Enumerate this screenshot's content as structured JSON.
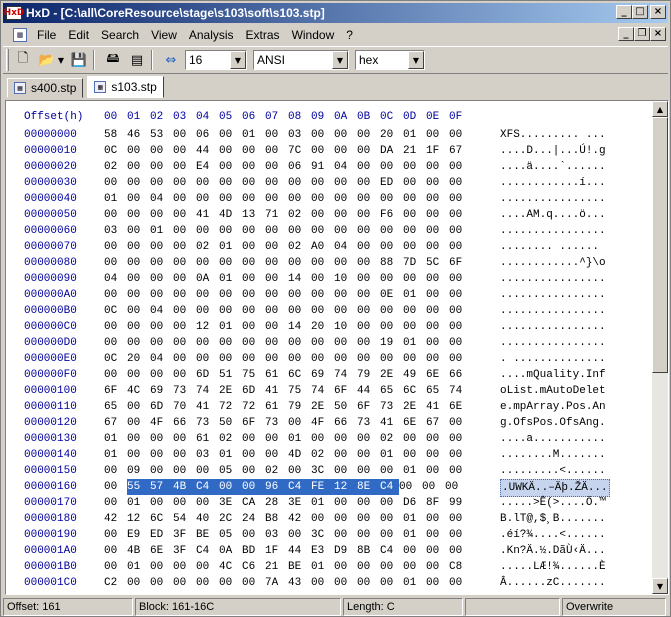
{
  "window": {
    "app_icon_text": "HxD",
    "title": "HxD - [C:\\all\\CoreResource\\stage\\s103\\soft\\s103.stp]"
  },
  "menu": {
    "items": [
      "File",
      "Edit",
      "Search",
      "View",
      "Analysis",
      "Extras",
      "Window",
      "?"
    ]
  },
  "toolbar": {
    "bytes_per_row": "16",
    "charset": "ANSI",
    "offset_base": "hex"
  },
  "tabs": [
    {
      "label": "s400.stp",
      "active": false
    },
    {
      "label": "s103.stp",
      "active": true
    }
  ],
  "hex": {
    "header_offset": "Offset(h)",
    "header_columns": [
      "00",
      "01",
      "02",
      "03",
      "04",
      "05",
      "06",
      "07",
      "08",
      "09",
      "0A",
      "0B",
      "0C",
      "0D",
      "0E",
      "0F"
    ],
    "rows": [
      {
        "offset": "00000000",
        "bytes": [
          "58",
          "46",
          "53",
          "00",
          "06",
          "00",
          "01",
          "00",
          "03",
          "00",
          "00",
          "00",
          "20",
          "01",
          "00",
          "00"
        ],
        "ascii": "XFS......... ..."
      },
      {
        "offset": "00000010",
        "bytes": [
          "0C",
          "00",
          "00",
          "00",
          "44",
          "00",
          "00",
          "00",
          "7C",
          "00",
          "00",
          "00",
          "DA",
          "21",
          "1F",
          "67"
        ],
        "ascii": "....D...|...Ú!.g"
      },
      {
        "offset": "00000020",
        "bytes": [
          "02",
          "00",
          "00",
          "00",
          "E4",
          "00",
          "00",
          "00",
          "06",
          "91",
          "04",
          "00",
          "00",
          "00",
          "00",
          "00"
        ],
        "ascii": "....ä....`......"
      },
      {
        "offset": "00000030",
        "bytes": [
          "00",
          "00",
          "00",
          "00",
          "00",
          "00",
          "00",
          "00",
          "00",
          "00",
          "00",
          "00",
          "ED",
          "00",
          "00",
          "00"
        ],
        "ascii": "............í..."
      },
      {
        "offset": "00000040",
        "bytes": [
          "01",
          "00",
          "04",
          "00",
          "00",
          "00",
          "00",
          "00",
          "00",
          "00",
          "00",
          "00",
          "00",
          "00",
          "00",
          "00"
        ],
        "ascii": "................"
      },
      {
        "offset": "00000050",
        "bytes": [
          "00",
          "00",
          "00",
          "00",
          "41",
          "4D",
          "13",
          "71",
          "02",
          "00",
          "00",
          "00",
          "F6",
          "00",
          "00",
          "00"
        ],
        "ascii": "....AM.q....ö..."
      },
      {
        "offset": "00000060",
        "bytes": [
          "03",
          "00",
          "01",
          "00",
          "00",
          "00",
          "00",
          "00",
          "00",
          "00",
          "00",
          "00",
          "00",
          "00",
          "00",
          "00"
        ],
        "ascii": "................"
      },
      {
        "offset": "00000070",
        "bytes": [
          "00",
          "00",
          "00",
          "00",
          "02",
          "01",
          "00",
          "00",
          "02",
          "A0",
          "04",
          "00",
          "00",
          "00",
          "00",
          "00"
        ],
        "ascii": "........ ......"
      },
      {
        "offset": "00000080",
        "bytes": [
          "00",
          "00",
          "00",
          "00",
          "00",
          "00",
          "00",
          "00",
          "00",
          "00",
          "00",
          "00",
          "88",
          "7D",
          "5C",
          "6F"
        ],
        "ascii": "............^}\\o"
      },
      {
        "offset": "00000090",
        "bytes": [
          "04",
          "00",
          "00",
          "00",
          "0A",
          "01",
          "00",
          "00",
          "14",
          "00",
          "10",
          "00",
          "00",
          "00",
          "00",
          "00"
        ],
        "ascii": "................"
      },
      {
        "offset": "000000A0",
        "bytes": [
          "00",
          "00",
          "00",
          "00",
          "00",
          "00",
          "00",
          "00",
          "00",
          "00",
          "00",
          "00",
          "0E",
          "01",
          "00",
          "00"
        ],
        "ascii": "................"
      },
      {
        "offset": "000000B0",
        "bytes": [
          "0C",
          "00",
          "04",
          "00",
          "00",
          "00",
          "00",
          "00",
          "00",
          "00",
          "00",
          "00",
          "00",
          "00",
          "00",
          "00"
        ],
        "ascii": "................"
      },
      {
        "offset": "000000C0",
        "bytes": [
          "00",
          "00",
          "00",
          "00",
          "12",
          "01",
          "00",
          "00",
          "14",
          "20",
          "10",
          "00",
          "00",
          "00",
          "00",
          "00"
        ],
        "ascii": "................"
      },
      {
        "offset": "000000D0",
        "bytes": [
          "00",
          "00",
          "00",
          "00",
          "00",
          "00",
          "00",
          "00",
          "00",
          "00",
          "00",
          "00",
          "19",
          "01",
          "00",
          "00"
        ],
        "ascii": "................"
      },
      {
        "offset": "000000E0",
        "bytes": [
          "0C",
          "20",
          "04",
          "00",
          "00",
          "00",
          "00",
          "00",
          "00",
          "00",
          "00",
          "00",
          "00",
          "00",
          "00",
          "00"
        ],
        "ascii": ". .............."
      },
      {
        "offset": "000000F0",
        "bytes": [
          "00",
          "00",
          "00",
          "00",
          "6D",
          "51",
          "75",
          "61",
          "6C",
          "69",
          "74",
          "79",
          "2E",
          "49",
          "6E",
          "66"
        ],
        "ascii": "....mQuality.Inf"
      },
      {
        "offset": "00000100",
        "bytes": [
          "6F",
          "4C",
          "69",
          "73",
          "74",
          "2E",
          "6D",
          "41",
          "75",
          "74",
          "6F",
          "44",
          "65",
          "6C",
          "65",
          "74"
        ],
        "ascii": "oList.mAutoDelet"
      },
      {
        "offset": "00000110",
        "bytes": [
          "65",
          "00",
          "6D",
          "70",
          "41",
          "72",
          "72",
          "61",
          "79",
          "2E",
          "50",
          "6F",
          "73",
          "2E",
          "41",
          "6E"
        ],
        "ascii": "e.mpArray.Pos.An"
      },
      {
        "offset": "00000120",
        "bytes": [
          "67",
          "00",
          "4F",
          "66",
          "73",
          "50",
          "6F",
          "73",
          "00",
          "4F",
          "66",
          "73",
          "41",
          "6E",
          "67",
          "00"
        ],
        "ascii": "g.OfsPos.OfsAng."
      },
      {
        "offset": "00000130",
        "bytes": [
          "01",
          "00",
          "00",
          "00",
          "61",
          "02",
          "00",
          "00",
          "01",
          "00",
          "00",
          "00",
          "02",
          "00",
          "00",
          "00"
        ],
        "ascii": "....a..........."
      },
      {
        "offset": "00000140",
        "bytes": [
          "01",
          "00",
          "00",
          "00",
          "03",
          "01",
          "00",
          "00",
          "4D",
          "02",
          "00",
          "00",
          "01",
          "00",
          "00",
          "00"
        ],
        "ascii": "........M......."
      },
      {
        "offset": "00000150",
        "bytes": [
          "00",
          "09",
          "00",
          "00",
          "00",
          "05",
          "00",
          "02",
          "00",
          "3C",
          "00",
          "00",
          "00",
          "01",
          "00",
          "00"
        ],
        "ascii": ".........<......"
      },
      {
        "offset": "00000160",
        "bytes": [
          "00",
          "55",
          "57",
          "4B",
          "C4",
          "00",
          "00",
          "96",
          "C4",
          "FE",
          "12",
          "8E",
          "C4",
          "00",
          "00",
          "00"
        ],
        "ascii": ".UWKÄ..–Äþ.ŽÄ...",
        "selected": true
      },
      {
        "offset": "00000170",
        "bytes": [
          "00",
          "01",
          "00",
          "00",
          "00",
          "3E",
          "CA",
          "28",
          "3E",
          "01",
          "00",
          "00",
          "00",
          "D6",
          "8F",
          "99"
        ],
        "ascii": ".....>Ê(>....Ö.™"
      },
      {
        "offset": "00000180",
        "bytes": [
          "42",
          "12",
          "6C",
          "54",
          "40",
          "2C",
          "24",
          "B8",
          "42",
          "00",
          "00",
          "00",
          "00",
          "01",
          "00",
          "00"
        ],
        "ascii": "B.lT@,$¸B......."
      },
      {
        "offset": "00000190",
        "bytes": [
          "00",
          "E9",
          "ED",
          "3F",
          "BE",
          "05",
          "00",
          "03",
          "00",
          "3C",
          "00",
          "00",
          "00",
          "01",
          "00",
          "00"
        ],
        "ascii": ".éí?¾....<......"
      },
      {
        "offset": "000001A0",
        "bytes": [
          "00",
          "4B",
          "6E",
          "3F",
          "C4",
          "0A",
          "BD",
          "1F",
          "44",
          "E3",
          "D9",
          "8B",
          "C4",
          "00",
          "00",
          "00"
        ],
        "ascii": ".Kn?Ä.½.DãÙ‹Ä..."
      },
      {
        "offset": "000001B0",
        "bytes": [
          "00",
          "01",
          "00",
          "00",
          "00",
          "4C",
          "C6",
          "21",
          "BE",
          "01",
          "00",
          "00",
          "00",
          "00",
          "00",
          "C8"
        ],
        "ascii": ".....LÆ!¾......È"
      },
      {
        "offset": "000001C0",
        "bytes": [
          "C2",
          "00",
          "00",
          "00",
          "00",
          "00",
          "00",
          "7A",
          "43",
          "00",
          "00",
          "00",
          "00",
          "01",
          "00",
          "00"
        ],
        "ascii": "Â......zC......."
      }
    ]
  },
  "statusbar": {
    "offset": "Offset: 161",
    "block": "Block: 161-16C",
    "length": "Length: C",
    "mode": "Overwrite"
  },
  "colors": {
    "title_gradient_start": "#0a246a",
    "title_gradient_end": "#a6caf0",
    "offset_text": "#0000a0",
    "selection": "#316ac5"
  }
}
